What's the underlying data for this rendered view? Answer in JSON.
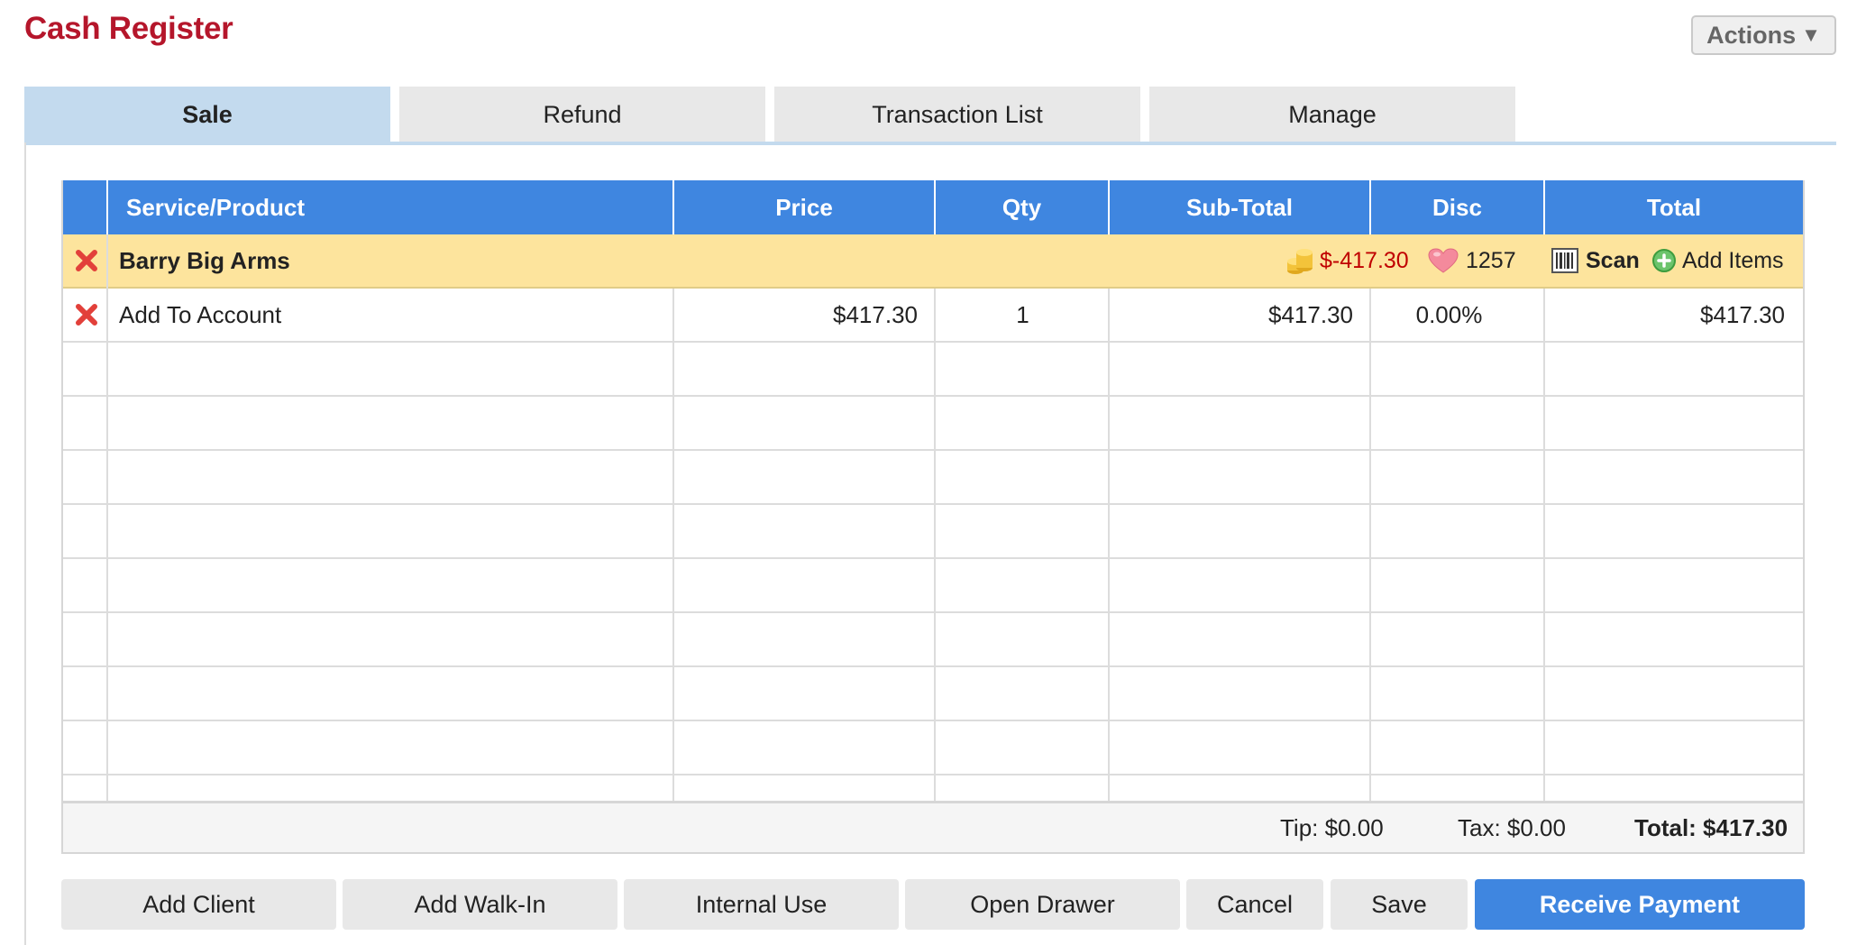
{
  "header": {
    "title": "Cash Register",
    "actions_label": "Actions"
  },
  "tabs": [
    {
      "label": "Sale",
      "active": true
    },
    {
      "label": "Refund",
      "active": false
    },
    {
      "label": "Transaction List",
      "active": false
    },
    {
      "label": "Manage",
      "active": false
    }
  ],
  "table": {
    "columns": [
      "Service/Product",
      "Price",
      "Qty",
      "Sub-Total",
      "Disc",
      "Total"
    ],
    "client": {
      "name": "Barry Big Arms",
      "balance": "$-417.30",
      "loyalty_points": "1257",
      "scan_label": "Scan",
      "add_items_label": "Add Items"
    },
    "rows": [
      {
        "product": "Add To Account",
        "price": "$417.30",
        "qty": "1",
        "subtotal": "$417.30",
        "disc": "0.00%",
        "total": "$417.30"
      }
    ]
  },
  "summary": {
    "tip": "Tip: $0.00",
    "tax": "Tax: $0.00",
    "total": "Total: $417.30"
  },
  "buttons": {
    "add_client": "Add Client",
    "add_walk_in": "Add Walk-In",
    "internal_use": "Internal Use",
    "open_drawer": "Open Drawer",
    "cancel": "Cancel",
    "save": "Save",
    "receive_payment": "Receive Payment"
  },
  "colors": {
    "brand_red": "#b5162b",
    "header_blue": "#3f86e0",
    "active_tab": "#c3daee",
    "client_row": "#fde49d"
  }
}
